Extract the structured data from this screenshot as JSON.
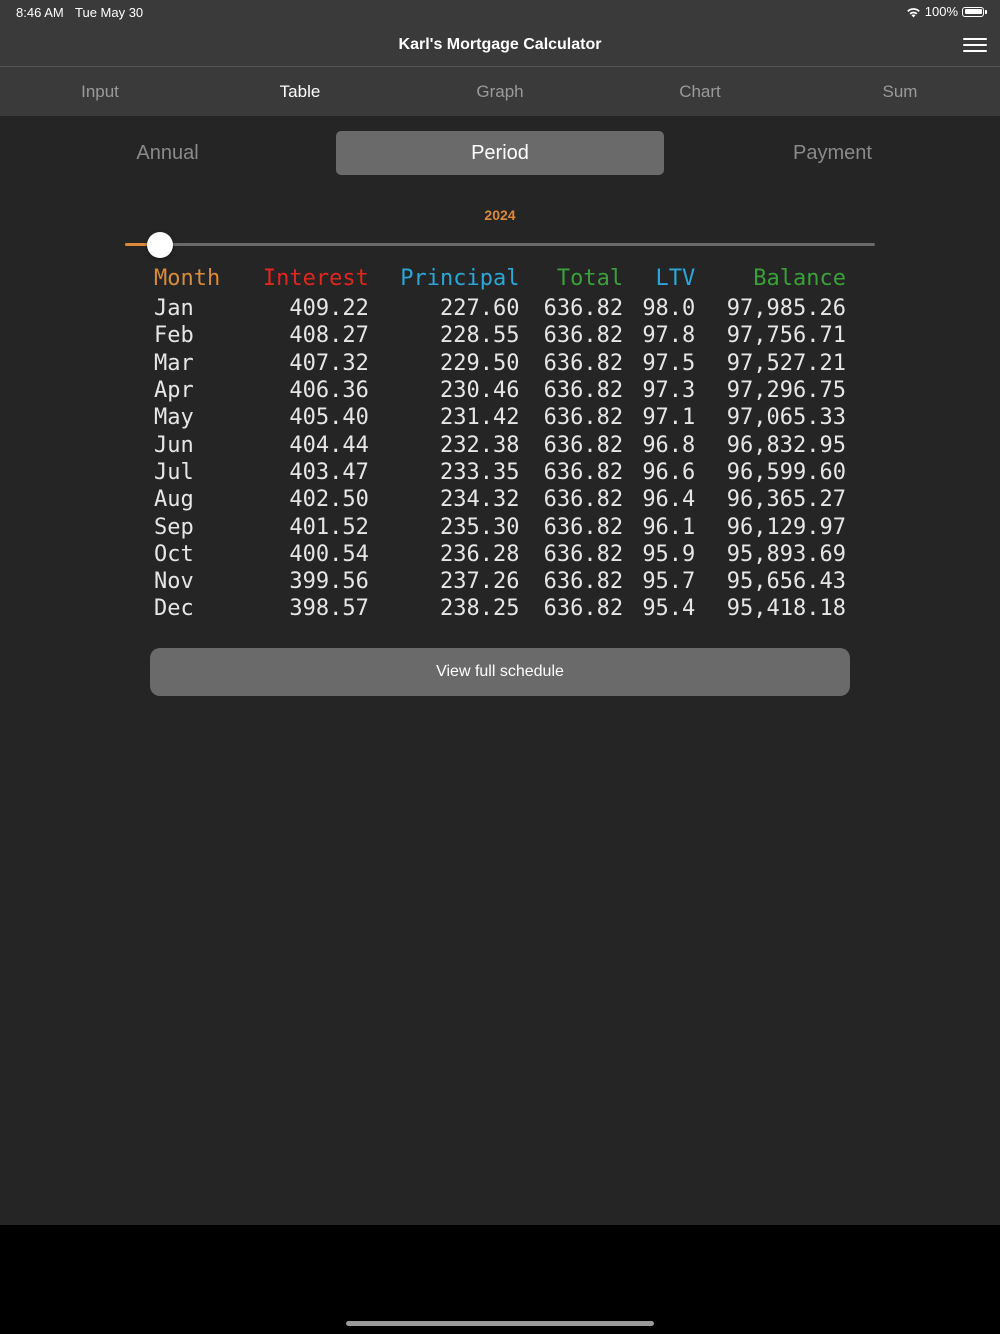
{
  "status": {
    "time": "8:46 AM",
    "date": "Tue May 30",
    "battery": "100%"
  },
  "app": {
    "title": "Karl's Mortgage Calculator"
  },
  "tabs": [
    {
      "label": "Input"
    },
    {
      "label": "Table"
    },
    {
      "label": "Graph"
    },
    {
      "label": "Chart"
    },
    {
      "label": "Sum"
    }
  ],
  "active_tab": "Table",
  "segments": [
    {
      "label": "Annual"
    },
    {
      "label": "Period"
    },
    {
      "label": "Payment"
    }
  ],
  "selected_segment": "Period",
  "year": "2024",
  "year_slider_position": 0.0,
  "table": {
    "headers": {
      "month": "Month",
      "interest": "Interest",
      "principal": "Principal",
      "total": "Total",
      "ltv": "LTV",
      "balance": "Balance"
    },
    "rows": [
      {
        "month": "Jan",
        "interest": "409.22",
        "principal": "227.60",
        "total": "636.82",
        "ltv": "98.0",
        "balance": "97,985.26"
      },
      {
        "month": "Feb",
        "interest": "408.27",
        "principal": "228.55",
        "total": "636.82",
        "ltv": "97.8",
        "balance": "97,756.71"
      },
      {
        "month": "Mar",
        "interest": "407.32",
        "principal": "229.50",
        "total": "636.82",
        "ltv": "97.5",
        "balance": "97,527.21"
      },
      {
        "month": "Apr",
        "interest": "406.36",
        "principal": "230.46",
        "total": "636.82",
        "ltv": "97.3",
        "balance": "97,296.75"
      },
      {
        "month": "May",
        "interest": "405.40",
        "principal": "231.42",
        "total": "636.82",
        "ltv": "97.1",
        "balance": "97,065.33"
      },
      {
        "month": "Jun",
        "interest": "404.44",
        "principal": "232.38",
        "total": "636.82",
        "ltv": "96.8",
        "balance": "96,832.95"
      },
      {
        "month": "Jul",
        "interest": "403.47",
        "principal": "233.35",
        "total": "636.82",
        "ltv": "96.6",
        "balance": "96,599.60"
      },
      {
        "month": "Aug",
        "interest": "402.50",
        "principal": "234.32",
        "total": "636.82",
        "ltv": "96.4",
        "balance": "96,365.27"
      },
      {
        "month": "Sep",
        "interest": "401.52",
        "principal": "235.30",
        "total": "636.82",
        "ltv": "96.1",
        "balance": "96,129.97"
      },
      {
        "month": "Oct",
        "interest": "400.54",
        "principal": "236.28",
        "total": "636.82",
        "ltv": "95.9",
        "balance": "95,893.69"
      },
      {
        "month": "Nov",
        "interest": "399.56",
        "principal": "237.26",
        "total": "636.82",
        "ltv": "95.7",
        "balance": "95,656.43"
      },
      {
        "month": "Dec",
        "interest": "398.57",
        "principal": "238.25",
        "total": "636.82",
        "ltv": "95.4",
        "balance": "95,418.18"
      }
    ]
  },
  "full_schedule_button": "View full schedule",
  "colors": {
    "accent_orange": "#d98a3a",
    "interest_red": "#e0261e",
    "blue": "#2aa7d8",
    "green": "#3aa13a"
  }
}
